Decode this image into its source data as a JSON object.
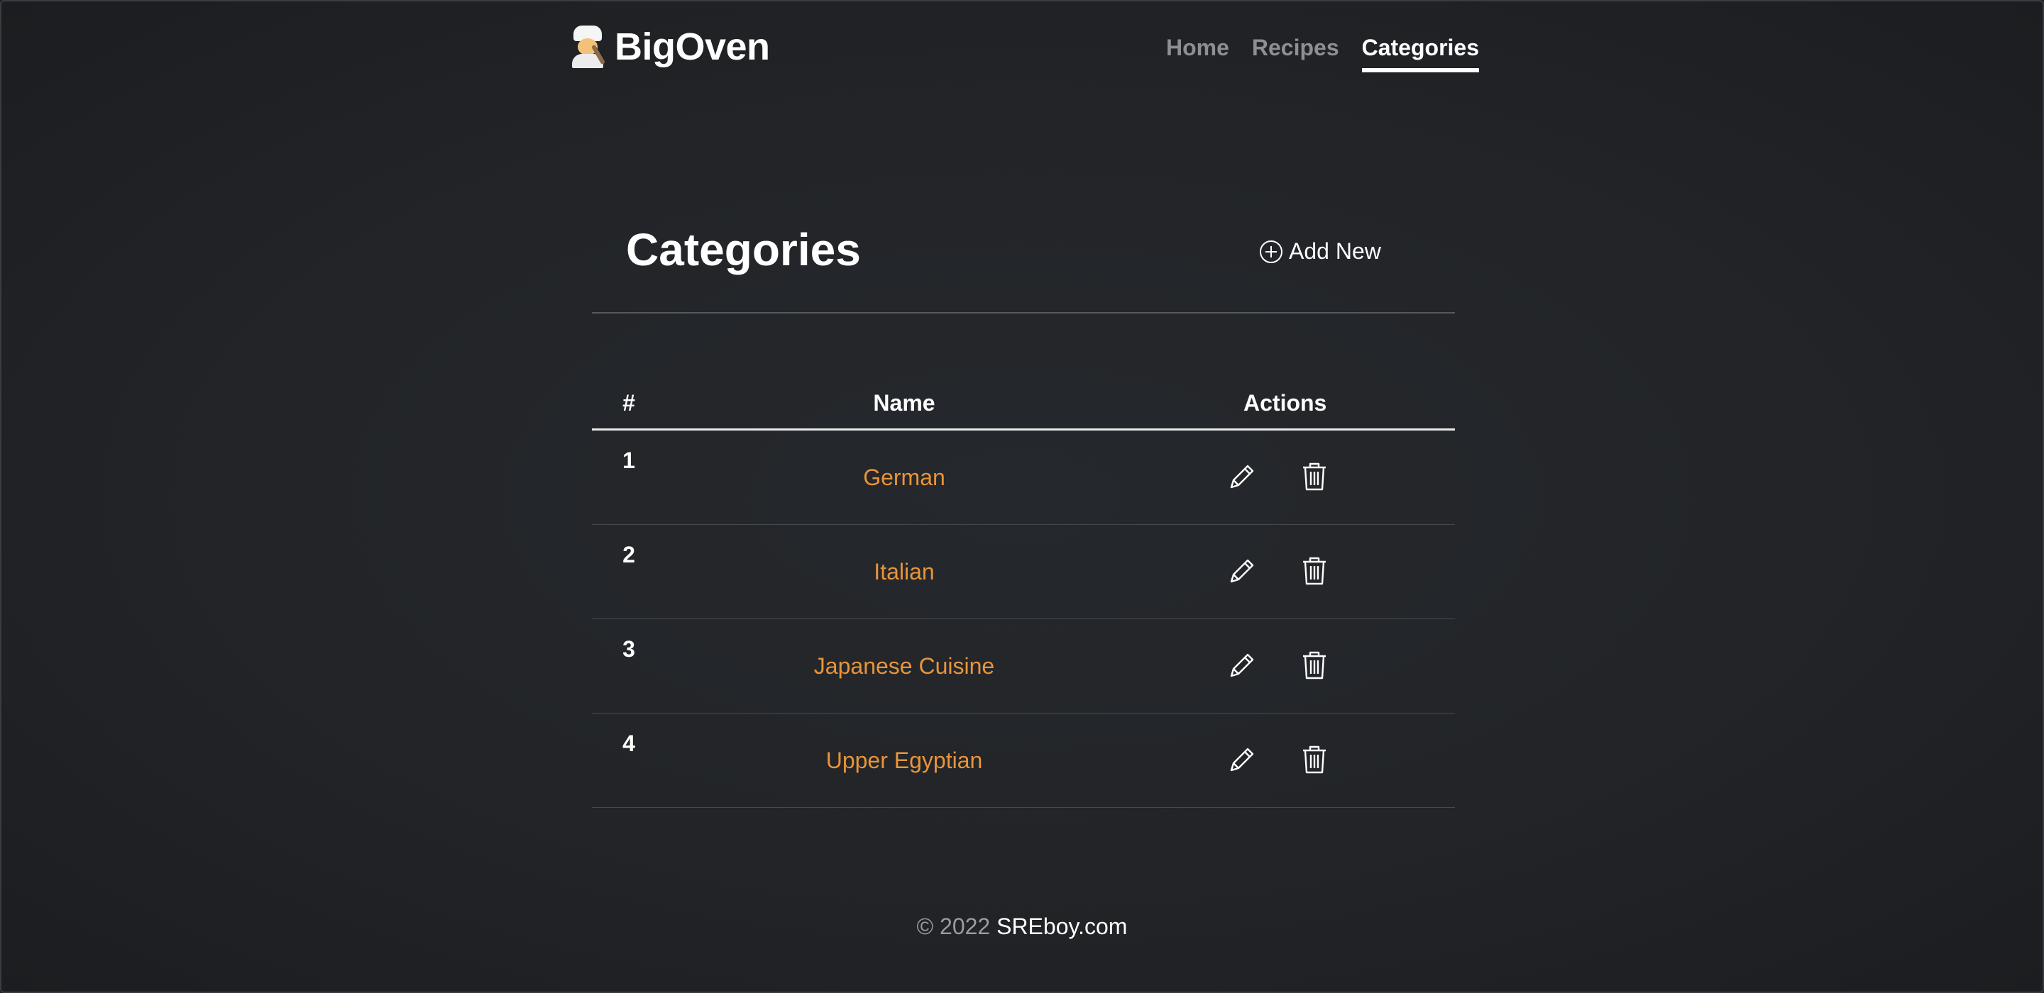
{
  "brand": {
    "name": "BigOven",
    "icon": "chef-emoji-icon"
  },
  "nav": {
    "items": [
      {
        "label": "Home",
        "active": false
      },
      {
        "label": "Recipes",
        "active": false
      },
      {
        "label": "Categories",
        "active": true
      }
    ]
  },
  "main": {
    "title": "Categories",
    "add_new_label": "Add New",
    "add_new_icon": "plus-circle-icon"
  },
  "table": {
    "headers": {
      "number": "#",
      "name": "Name",
      "actions": "Actions"
    },
    "rows": [
      {
        "number": "1",
        "name": "German"
      },
      {
        "number": "2",
        "name": "Italian"
      },
      {
        "number": "3",
        "name": "Japanese Cuisine"
      },
      {
        "number": "4",
        "name": "Upper Egyptian"
      }
    ],
    "action_icons": [
      "pencil-icon",
      "trash-icon"
    ]
  },
  "footer": {
    "copyright": "© 2022",
    "site": "SREboy.com"
  },
  "colors": {
    "background": "#222428",
    "link_accent": "#e8943a",
    "nav_inactive": "#8d8f92",
    "text": "#ffffff"
  }
}
